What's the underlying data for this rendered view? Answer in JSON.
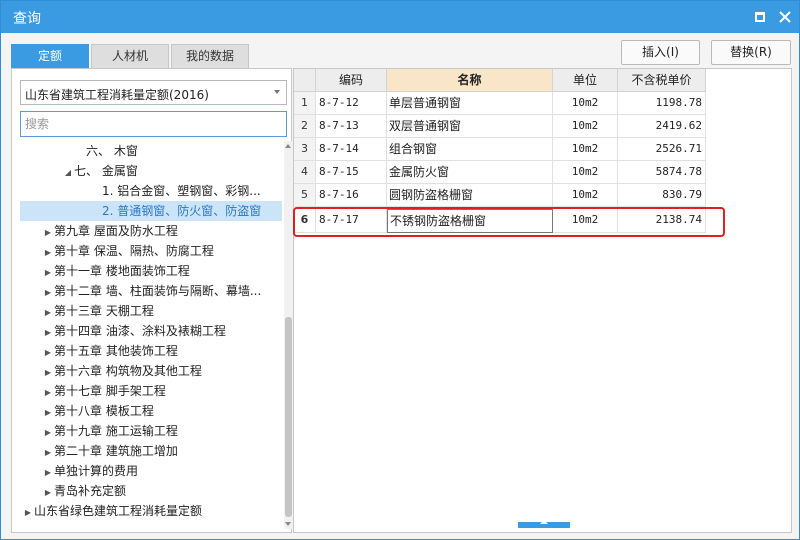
{
  "window": {
    "title": "查询"
  },
  "tabs": [
    {
      "label": "定额",
      "active": true
    },
    {
      "label": "人材机",
      "active": false
    },
    {
      "label": "我的数据",
      "active": false
    }
  ],
  "buttons": {
    "insert": "插入(I)",
    "replace": "替换(R)"
  },
  "left": {
    "selected_db": "山东省建筑工程消耗量定额(2016)",
    "search_placeholder": "搜索",
    "tree": [
      {
        "label": "六、 木窗"
      },
      {
        "label": "七、 金属窗"
      },
      {
        "label": "1. 铝合金窗、塑钢窗、彩钢..."
      },
      {
        "label": "2. 普通钢窗、防火窗、防盗窗"
      },
      {
        "label": "第九章 屋面及防水工程"
      },
      {
        "label": "第十章 保温、隔热、防腐工程"
      },
      {
        "label": "第十一章 楼地面装饰工程"
      },
      {
        "label": "第十二章 墙、柱面装饰与隔断、幕墙..."
      },
      {
        "label": "第十三章 天棚工程"
      },
      {
        "label": "第十四章 油漆、涂料及裱糊工程"
      },
      {
        "label": "第十五章 其他装饰工程"
      },
      {
        "label": "第十六章 构筑物及其他工程"
      },
      {
        "label": "第十七章 脚手架工程"
      },
      {
        "label": "第十八章 模板工程"
      },
      {
        "label": "第十九章 施工运输工程"
      },
      {
        "label": "第二十章 建筑施工增加"
      },
      {
        "label": "单独计算的费用"
      },
      {
        "label": "青岛补充定额"
      },
      {
        "label": "山东省绿色建筑工程消耗量定额"
      }
    ]
  },
  "table": {
    "headers": {
      "code": "编码",
      "name": "名称",
      "unit": "单位",
      "price": "不含税单价"
    },
    "rows": [
      {
        "n": "1",
        "code": "8-7-12",
        "name": "单层普通钢窗",
        "unit": "10m2",
        "price": "1198.78"
      },
      {
        "n": "2",
        "code": "8-7-13",
        "name": "双层普通钢窗",
        "unit": "10m2",
        "price": "2419.62"
      },
      {
        "n": "3",
        "code": "8-7-14",
        "name": "组合钢窗",
        "unit": "10m2",
        "price": "2526.71"
      },
      {
        "n": "4",
        "code": "8-7-15",
        "name": "金属防火窗",
        "unit": "10m2",
        "price": "5874.78"
      },
      {
        "n": "5",
        "code": "8-7-16",
        "name": "圆钢防盗格栅窗",
        "unit": "10m2",
        "price": "830.79"
      },
      {
        "n": "6",
        "code": "8-7-17",
        "name": "不锈钢防盗格栅窗",
        "unit": "10m2",
        "price": "2138.74"
      }
    ]
  },
  "colors": {
    "accent": "#3a9be2",
    "highlight": "#e02020",
    "name_header": "#f9e5c8",
    "selection": "#cce4f7"
  }
}
